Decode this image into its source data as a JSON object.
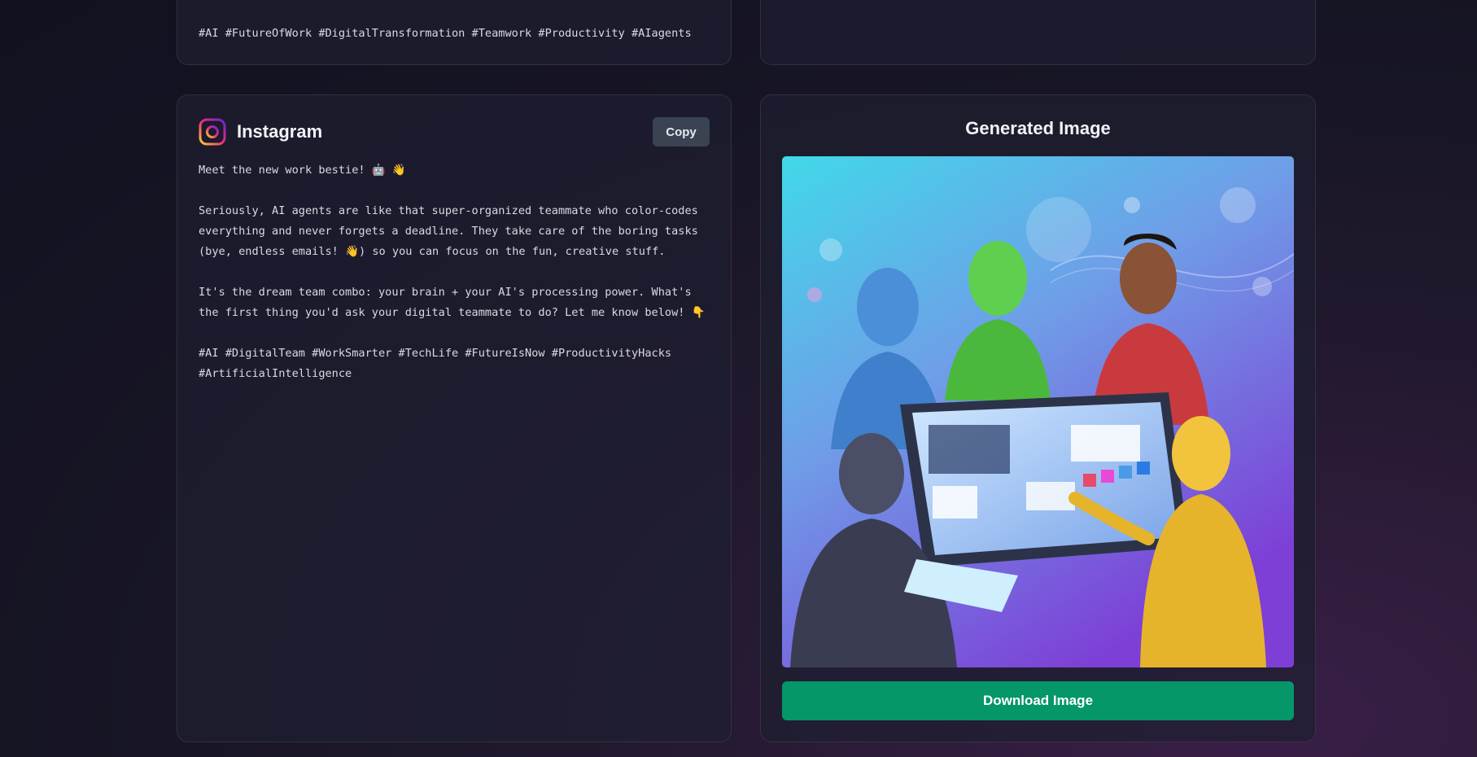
{
  "top_card": {
    "hashtags": "#AI #FutureOfWork #DigitalTransformation #Teamwork #Productivity #AIagents"
  },
  "instagram": {
    "title": "Instagram",
    "copy_label": "Copy",
    "icon": "instagram-icon",
    "brand_colors": [
      "#f9ce34",
      "#ee2a7b",
      "#6228d7"
    ],
    "paragraphs": [
      "Meet the new work bestie! 🤖 👋",
      "Seriously, AI agents are like that super-organized teammate who color-codes everything and never forgets a deadline. They take care of the boring tasks (bye, endless emails! 👋) so you can focus on the fun, creative stuff.",
      "It's the dream team combo: your brain + your AI's processing power. What's the first thing you'd ask your digital teammate to do? Let me know below! 👇",
      "#AI #DigitalTeam #WorkSmarter #TechLife #FutureIsNow #ProductivityHacks #ArtificialIntelligence"
    ]
  },
  "generated": {
    "title": "Generated Image",
    "download_label": "Download Image",
    "button_color": "#059669"
  }
}
